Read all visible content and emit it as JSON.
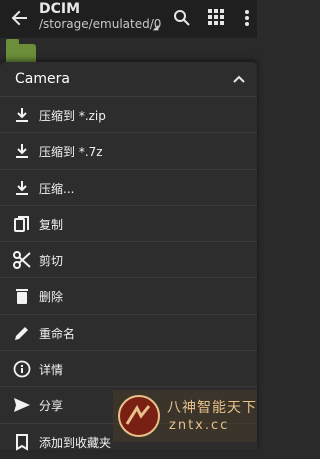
{
  "appbar": {
    "title": "DCIM",
    "path": "/storage/emulated/0",
    "icons": [
      "back-arrow-icon",
      "search-icon",
      "grid-view-icon",
      "more-vert-icon"
    ]
  },
  "sheet": {
    "title": "Camera",
    "items": [
      {
        "label": "压缩到 *.zip",
        "icon": "download-icon"
      },
      {
        "label": "压缩到 *.7z",
        "icon": "download-icon"
      },
      {
        "label": "压缩...",
        "icon": "download-icon"
      },
      {
        "label": "复制",
        "icon": "copy-icon"
      },
      {
        "label": "剪切",
        "icon": "scissors-icon"
      },
      {
        "label": "删除",
        "icon": "trash-icon"
      },
      {
        "label": "重命名",
        "icon": "pencil-icon"
      },
      {
        "label": "详情",
        "icon": "info-icon"
      },
      {
        "label": "分享",
        "icon": "send-icon"
      },
      {
        "label": "添加到收藏夹",
        "icon": "bookmark-icon"
      }
    ]
  },
  "watermark": {
    "cn": "八神智能天下",
    "en": "zntx.cc"
  },
  "colors": {
    "background": "#2a2a2a",
    "appbar": "#1f1f1f",
    "sheet": "#2d2d2d",
    "text": "#ffffff",
    "watermark": "#e8c08a"
  }
}
